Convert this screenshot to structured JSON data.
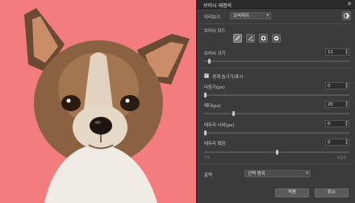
{
  "window": {
    "title": "브러시 재정의",
    "close_glyph": "✕"
  },
  "preview": {
    "label": "미리보기",
    "value": "오버레이",
    "icon": "contrast-icon"
  },
  "brush_mode": {
    "label": "브러시 모드",
    "tools": [
      "brush-add-icon",
      "brush-subtract-icon",
      "brush-add-circle-icon",
      "brush-subtract-circle-icon"
    ]
  },
  "brush_size": {
    "label": "브러시 크기",
    "value": "11",
    "slider_fraction": 0.03
  },
  "refine": {
    "checkbox_label": "경계 숨기기/표시",
    "checked": true
  },
  "smooth": {
    "label": "다듬기(px)",
    "value": "0",
    "slider_fraction": 0.0
  },
  "feather": {
    "label": "페더(px)",
    "value": "20",
    "slider_fraction": 0.2
  },
  "edge_width": {
    "label": "테두리 너비(px)",
    "value": "0",
    "slider_fraction": 0.0
  },
  "edge_expand": {
    "label": "테두리 확장",
    "value": "0",
    "slider_fraction": 0.5,
    "min_label": "안쪽",
    "max_label": "바깥쪽"
  },
  "output": {
    "label": "출력",
    "value": "선택 범위"
  },
  "buttons": {
    "ok": "적용",
    "cancel": "취소"
  }
}
